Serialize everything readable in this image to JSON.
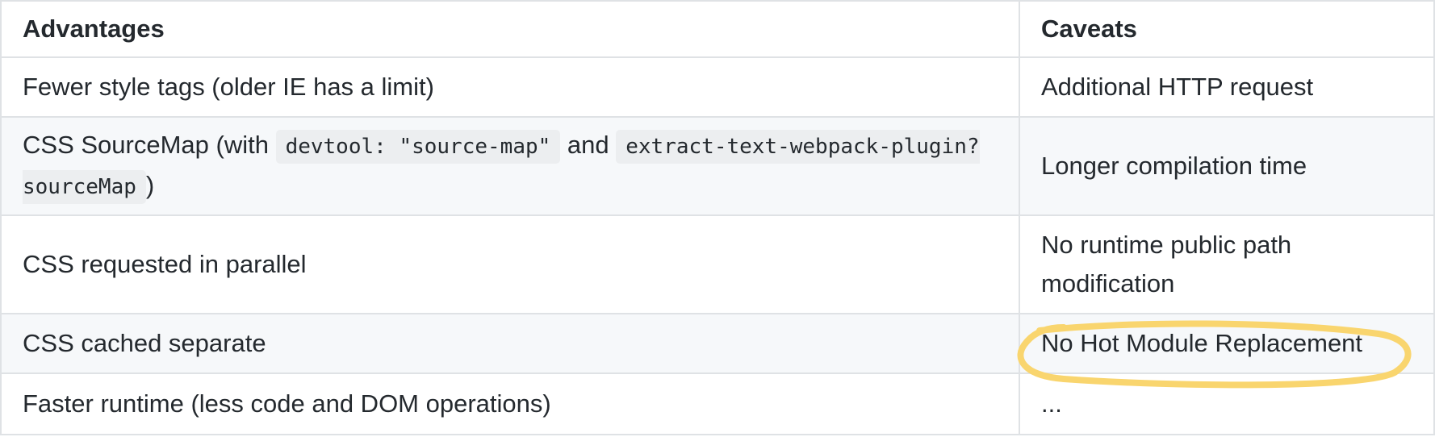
{
  "table": {
    "headers": [
      "Advantages",
      "Caveats"
    ],
    "rows": [
      {
        "advantage": {
          "parts": [
            {
              "text": "Fewer style tags (older IE has a limit)"
            }
          ]
        },
        "caveat": "Additional HTTP request"
      },
      {
        "advantage": {
          "parts": [
            {
              "text": "CSS SourceMap (with "
            },
            {
              "code": "devtool: \"source-map\""
            },
            {
              "text": " and "
            },
            {
              "code": "extract-text-webpack-plugin?sourceMap"
            },
            {
              "text": ")"
            }
          ]
        },
        "caveat": "Longer compilation time"
      },
      {
        "advantage": {
          "parts": [
            {
              "text": "CSS requested in parallel"
            }
          ]
        },
        "caveat": "No runtime public path modification"
      },
      {
        "advantage": {
          "parts": [
            {
              "text": "CSS cached separate"
            }
          ]
        },
        "caveat": "No Hot Module Replacement"
      },
      {
        "advantage": {
          "parts": [
            {
              "text": "Faster runtime (less code and DOM operations)"
            }
          ]
        },
        "caveat": "..."
      }
    ]
  },
  "annotation": {
    "highlighted_row": 3,
    "color": "#f9d56e"
  },
  "colors": {
    "border": "#dfe2e5",
    "stripe": "#f6f8fa",
    "text": "#24292e",
    "code_bg": "#eceef0"
  }
}
